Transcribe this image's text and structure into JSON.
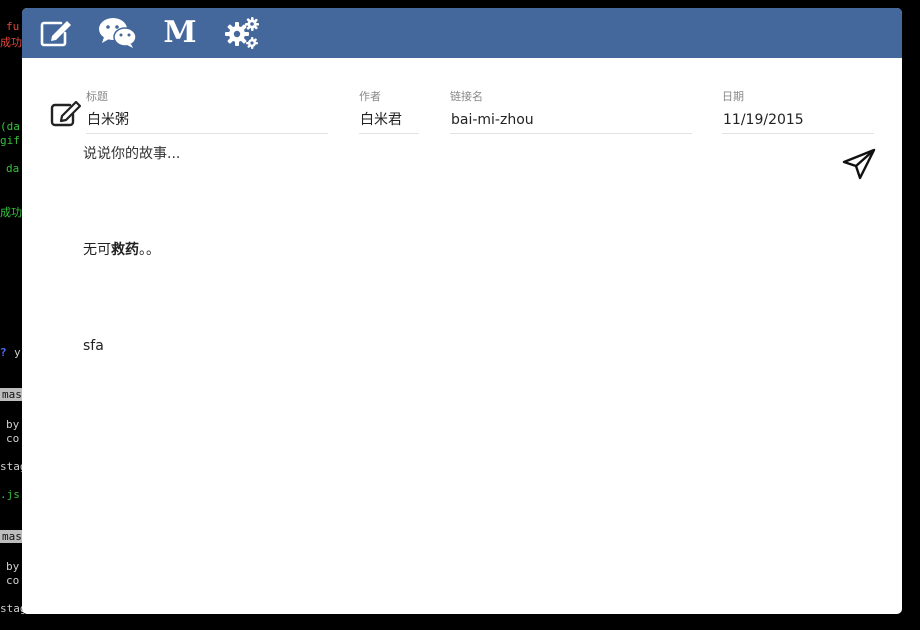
{
  "terminal": {
    "lines": [
      "fu",
      "成功",
      "(da",
      "gif",
      "da",
      "成功",
      "?",
      "y",
      "mas",
      "by",
      "co",
      "stag",
      ".js",
      "mas",
      "by",
      "co",
      "stag"
    ]
  },
  "toolbar": {
    "buttons": [
      "edit-icon",
      "wechat-icon",
      "medium-icon",
      "settings-gears-icon"
    ],
    "medium_letter": "M",
    "bg_color": "#44689c"
  },
  "form": {
    "title_label": "标题",
    "title_value": "白米粥",
    "author_label": "作者",
    "author_value": "白米君",
    "slug_label": "链接名",
    "slug_value": "bai-mi-zhou",
    "date_label": "日期",
    "date_value": "11/19/2015"
  },
  "story": {
    "placeholder": "说说你的故事...",
    "para1_prefix": "无可",
    "para1_bold": "救药",
    "para1_suffix": "。。",
    "para2": "sfa"
  }
}
